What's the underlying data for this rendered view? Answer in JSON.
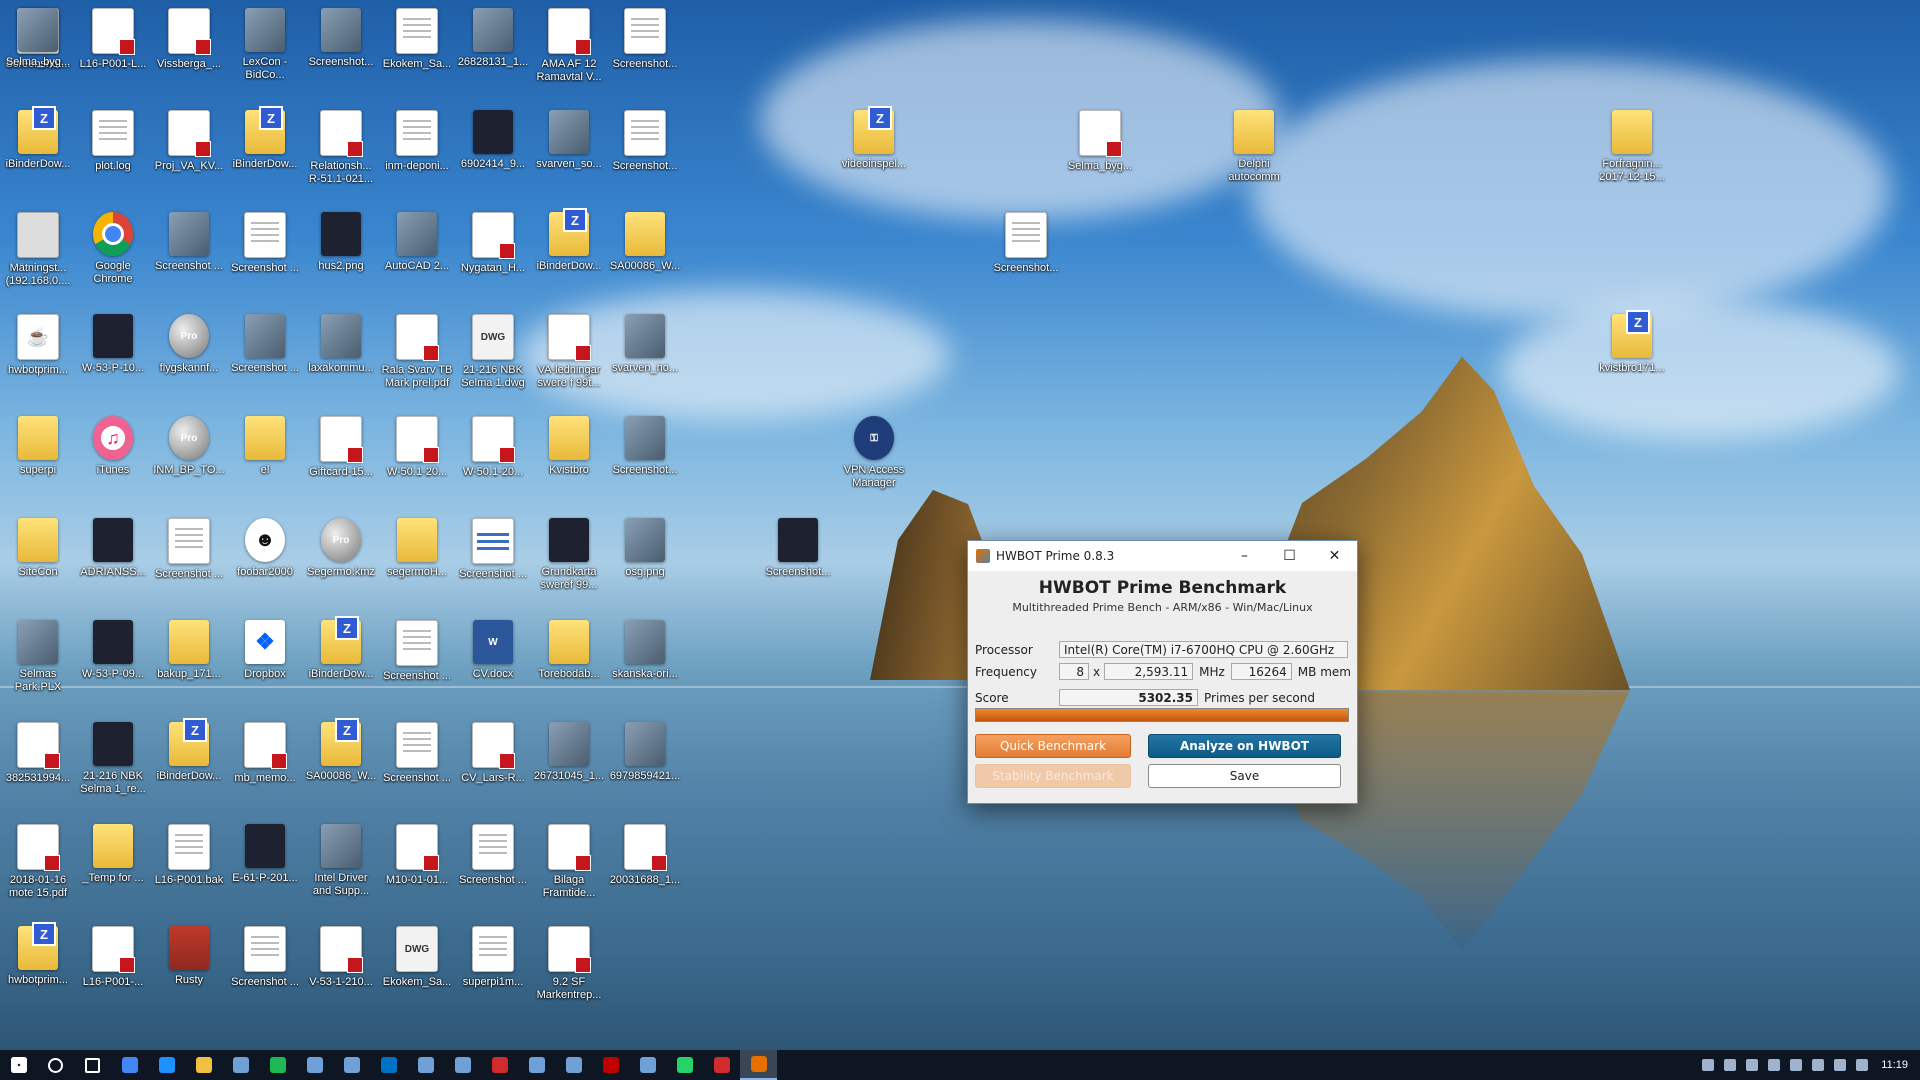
{
  "desktop_icons": [
    {
      "label": "Screenshot...",
      "type": "doc"
    },
    {
      "label": "L16-P001-L...",
      "type": "pdf"
    },
    {
      "label": "Vissberga_...",
      "type": "pdf"
    },
    {
      "label": "LexCon - BidCo...",
      "type": "image"
    },
    {
      "label": "Screenshot...",
      "type": "image"
    },
    {
      "label": "Ekokem_Sa...",
      "type": "doc"
    },
    {
      "label": "26828131_1...",
      "type": "image"
    },
    {
      "label": "AMA AF 12 Ramavtal V...",
      "type": "pdf"
    },
    {
      "label": "Screenshot...",
      "type": "doc"
    },
    {
      "label": "iBinderDow...",
      "type": "zip"
    },
    {
      "label": "plot.log",
      "type": "doc"
    },
    {
      "label": "Proj_VA_KV...",
      "type": "pdf"
    },
    {
      "label": "iBinderDow...",
      "type": "zip"
    },
    {
      "label": "Relationsh... R-51.1-021...",
      "type": "pdf"
    },
    {
      "label": "inm-deponi...",
      "type": "doc"
    },
    {
      "label": "6902414_9...",
      "type": "dark"
    },
    {
      "label": "svarven_so...",
      "type": "image"
    },
    {
      "label": "Screenshot...",
      "type": "doc"
    },
    {
      "label": "videoinspel...",
      "type": "zip"
    },
    {
      "label": "Selma_byg...",
      "type": "pdf"
    },
    {
      "label": "Delphi autocomm",
      "type": "folder"
    },
    {
      "label": "Forfragnin... 2017-12-15...",
      "type": "folder"
    },
    {
      "label": "Mätningst... (192.168.0....",
      "type": "net"
    },
    {
      "label": "Google Chrome",
      "type": "chrome"
    },
    {
      "label": "Screenshot ...",
      "type": "image"
    },
    {
      "label": "Screenshot ...",
      "type": "doc"
    },
    {
      "label": "hus2.png",
      "type": "dark"
    },
    {
      "label": "AutoCAD 2...",
      "type": "image"
    },
    {
      "label": "Nygatan_H...",
      "type": "pdf"
    },
    {
      "label": "iBinderDow...",
      "type": "zip"
    },
    {
      "label": "SA00086_W...",
      "type": "folder"
    },
    {
      "label": "Screenshot...",
      "type": "doc"
    },
    {
      "label": "hwbotprim...",
      "type": "java"
    },
    {
      "label": "W-53-P-10...",
      "type": "dark"
    },
    {
      "label": "flygskannf...",
      "type": "earth"
    },
    {
      "label": "Screenshot ...",
      "type": "image"
    },
    {
      "label": "laxakommu...",
      "type": "image"
    },
    {
      "label": "Rala Svarv TB Mark prel.pdf",
      "type": "pdf"
    },
    {
      "label": "21-216 NBK Selma 1.dwg",
      "type": "dwg"
    },
    {
      "label": "VA-ledningar swere f 99t...",
      "type": "pdf"
    },
    {
      "label": "svarven_no...",
      "type": "image"
    },
    {
      "label": "kvistbro171...",
      "type": "zip"
    },
    {
      "label": "superpi",
      "type": "folder"
    },
    {
      "label": "iTunes",
      "type": "itunes"
    },
    {
      "label": "INM_BP_TO...",
      "type": "earth"
    },
    {
      "label": "el",
      "type": "folder"
    },
    {
      "label": "Giftcard-15...",
      "type": "pdf"
    },
    {
      "label": "W-50.1-20...",
      "type": "pdf"
    },
    {
      "label": "W-50.1-20...",
      "type": "pdf"
    },
    {
      "label": "Kvistbro",
      "type": "folder"
    },
    {
      "label": "Screenshot...",
      "type": "image"
    },
    {
      "label": "VPN Access Manager",
      "type": "vpn"
    },
    {
      "label": "SiteCon",
      "type": "folder"
    },
    {
      "label": "ADRIANSS...",
      "type": "dark"
    },
    {
      "label": "Screenshot ...",
      "type": "doc"
    },
    {
      "label": "foobar2000",
      "type": "fox"
    },
    {
      "label": "Segermo.kmz",
      "type": "earth"
    },
    {
      "label": "segermoH...",
      "type": "folder"
    },
    {
      "label": "Screenshot ...",
      "type": "lines"
    },
    {
      "label": "Grundkarta sweref 99...",
      "type": "dark"
    },
    {
      "label": "osg.png",
      "type": "image"
    },
    {
      "label": "Screenshot...",
      "type": "dark"
    },
    {
      "label": "Selmas Park.PLX",
      "type": "image"
    },
    {
      "label": "W-53-P-09...",
      "type": "dark"
    },
    {
      "label": "bakup_171...",
      "type": "folder"
    },
    {
      "label": "Dropbox",
      "type": "dropbox"
    },
    {
      "label": "iBinderDow...",
      "type": "zip"
    },
    {
      "label": "Screenshot ...",
      "type": "doc"
    },
    {
      "label": "CV.docx",
      "type": "word"
    },
    {
      "label": "Torebodab...",
      "type": "folder"
    },
    {
      "label": "skanska-ori...",
      "type": "image"
    },
    {
      "label": "382531994...",
      "type": "pdf"
    },
    {
      "label": "21-216 NBK Selma 1_re...",
      "type": "dark"
    },
    {
      "label": "iBinderDow...",
      "type": "zip"
    },
    {
      "label": "mb_memo...",
      "type": "pdf"
    },
    {
      "label": "SA00086_W...",
      "type": "zip"
    },
    {
      "label": "Screenshot ...",
      "type": "doc"
    },
    {
      "label": "CV_Lars-R...",
      "type": "pdf"
    },
    {
      "label": "26731045_1...",
      "type": "image"
    },
    {
      "label": "6979859421...",
      "type": "image"
    },
    {
      "label": "2018-01-16 mote 15.pdf",
      "type": "pdf"
    },
    {
      "label": "_Temp for ...",
      "type": "folder"
    },
    {
      "label": "L16-P001.bak",
      "type": "doc"
    },
    {
      "label": "E-61-P-201...",
      "type": "dark"
    },
    {
      "label": "Intel Driver and Supp...",
      "type": "image"
    },
    {
      "label": "M10-01-01...",
      "type": "pdf"
    },
    {
      "label": "Screenshot ...",
      "type": "doc"
    },
    {
      "label": "Bilaga Framtide...",
      "type": "pdf"
    },
    {
      "label": "20031688_1...",
      "type": "pdf"
    },
    {
      "label": "hwbotprim...",
      "type": "zip"
    },
    {
      "label": "L16-P001-...",
      "type": "pdf"
    },
    {
      "label": "Rusty",
      "type": "rusty"
    },
    {
      "label": "Screenshot ...",
      "type": "doc"
    },
    {
      "label": "V-53-1-210...",
      "type": "pdf"
    },
    {
      "label": "Ekokem_Sa...",
      "type": "dwg"
    },
    {
      "label": "superpi1m...",
      "type": "doc"
    },
    {
      "label": "9.2 SF Markentrep...",
      "type": "pdf"
    },
    {
      "label": "Selma_byg...",
      "type": "image"
    }
  ],
  "window": {
    "title": "HWBOT Prime 0.8.3",
    "heading": "HWBOT Prime Benchmark",
    "subheading": "Multithreaded Prime Bench - ARM/x86 - Win/Mac/Linux",
    "processor_label": "Processor",
    "processor_value": "Intel(R) Core(TM) i7-6700HQ CPU @ 2.60GHz",
    "frequency_label": "Frequency",
    "threads": "8",
    "times": "x",
    "frequency_value": "2,593.11",
    "mhz": "MHz",
    "memory_value": "16264",
    "mem_unit": "MB mem",
    "score_label": "Score",
    "score_value": "5302.35",
    "score_unit": "Primes per second",
    "progress": 1.0,
    "quick_button": "Quick Benchmark",
    "analyze_button": "Analyze on HWBOT",
    "stability_button": "Stability Benchmark",
    "save_button": "Save"
  },
  "taskbar": {
    "clock": "11:19",
    "apps": [
      "start",
      "search",
      "task-view",
      "chrome",
      "edge",
      "explorer",
      "app",
      "spotify",
      "app",
      "app",
      "outlook",
      "app",
      "app",
      "acrobat",
      "app",
      "app",
      "filezilla",
      "app",
      "whatsapp",
      "acrobat",
      "java"
    ]
  },
  "colors": {
    "accent": "#e27d34",
    "blue": "#0e5a85",
    "taskbar": "#0d1622"
  }
}
